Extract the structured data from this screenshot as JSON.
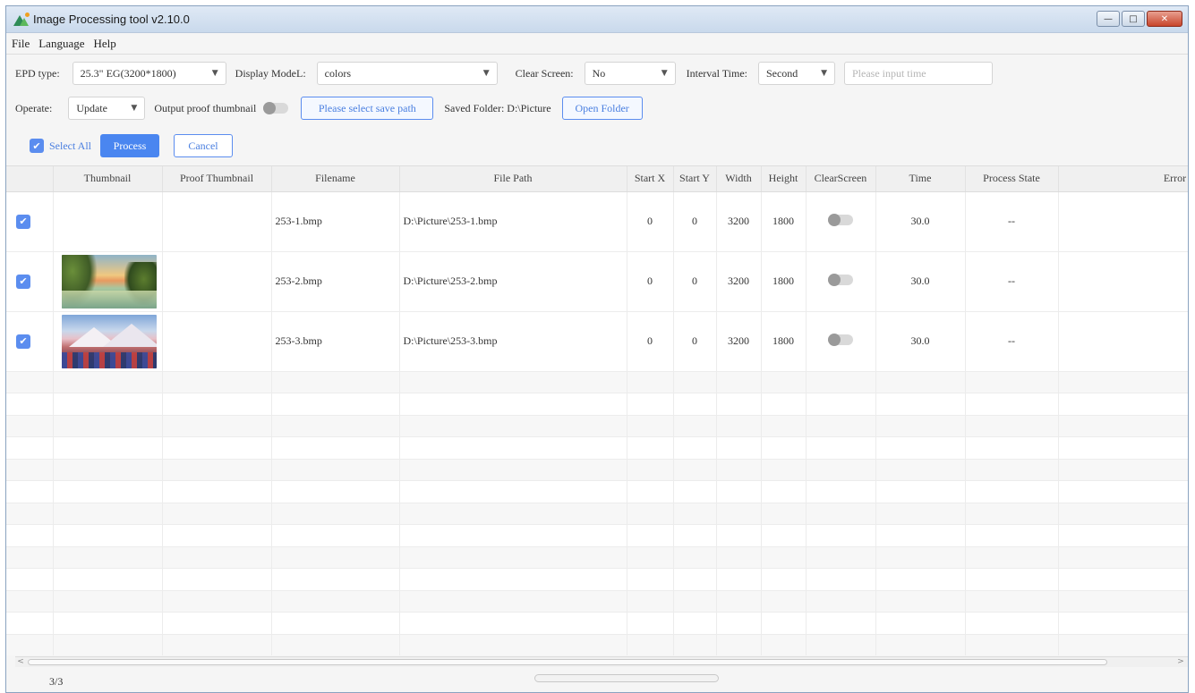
{
  "window": {
    "title": "Image Processing tool v2.10.0",
    "controls": [
      "—",
      "□",
      "✕"
    ]
  },
  "menu": [
    "File",
    "Language",
    "Help"
  ],
  "toolbar": {
    "epd_type_label": "EPD type:",
    "epd_type_value": "25.3\" EG(3200*1800)",
    "display_model_label": "Display ModeL:",
    "display_model_value": "colors",
    "clear_screen_label": "Clear Screen:",
    "clear_screen_value": "No",
    "interval_time_label": "Interval Time:",
    "interval_unit_value": "Second",
    "interval_time_value": "",
    "interval_time_placeholder": "Please input time",
    "operate_label": "Operate:",
    "operate_value": "Update",
    "output_proof_label": "Output proof thumbnail",
    "output_proof_on": false,
    "select_save_path_label": "Please select save path",
    "saved_folder_label": "Saved Folder: D:\\Picture",
    "open_folder_label": "Open Folder",
    "select_all_label": "Select All",
    "select_all_checked": true,
    "process_label": "Process",
    "cancel_label": "Cancel"
  },
  "table": {
    "columns": [
      "",
      "Thumbnail",
      "Proof Thumbnail",
      "Filename",
      "File Path",
      "Start X",
      "Start Y",
      "Width",
      "Height",
      "ClearScreen",
      "Time",
      "Process State",
      "Error Msg"
    ],
    "rows": [
      {
        "checked": true,
        "thumbnail": "",
        "proof": "",
        "filename": "253-1.bmp",
        "path": "D:\\Picture\\253-1.bmp",
        "start_x": "0",
        "start_y": "0",
        "width": "3200",
        "height": "1800",
        "clear_screen": false,
        "time": "30.0",
        "state": "--",
        "error": ""
      },
      {
        "checked": true,
        "thumbnail": "landscape-lake",
        "proof": "",
        "filename": "253-2.bmp",
        "path": "D:\\Picture\\253-2.bmp",
        "start_x": "0",
        "start_y": "0",
        "width": "3200",
        "height": "1800",
        "clear_screen": false,
        "time": "30.0",
        "state": "--",
        "error": ""
      },
      {
        "checked": true,
        "thumbnail": "snow-mountains",
        "proof": "",
        "filename": "253-3.bmp",
        "path": "D:\\Picture\\253-3.bmp",
        "start_x": "0",
        "start_y": "0",
        "width": "3200",
        "height": "1800",
        "clear_screen": false,
        "time": "30.0",
        "state": "--",
        "error": ""
      }
    ]
  },
  "status": {
    "count": "3/3",
    "progress": 0
  },
  "colors": {
    "accent": "#4a86f0",
    "outline": "#5b8def"
  },
  "icons": {
    "app": "mountain-image-icon",
    "dropdown": "chevron-down-icon",
    "check": "checkmark-icon"
  }
}
